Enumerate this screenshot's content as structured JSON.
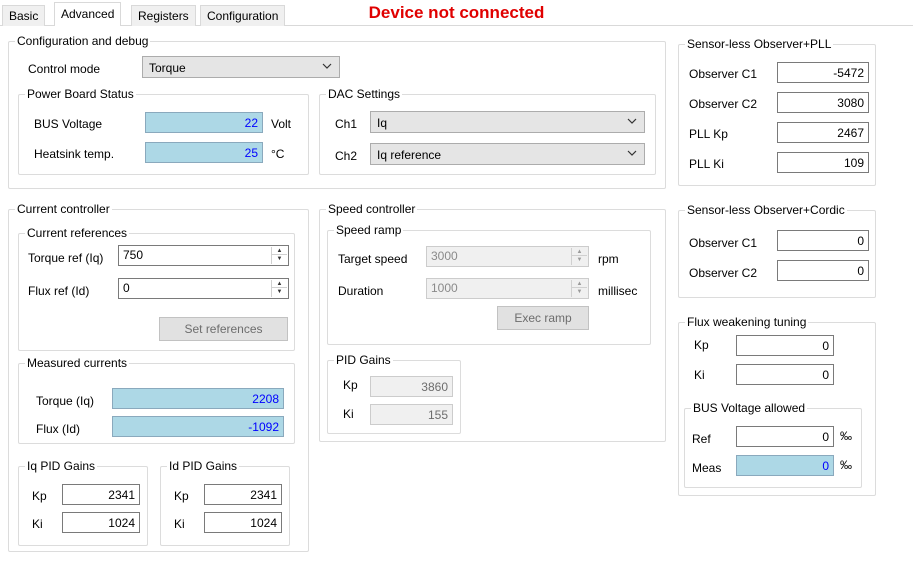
{
  "tabs": [
    {
      "label": "Basic"
    },
    {
      "label": "Advanced"
    },
    {
      "label": "Registers"
    },
    {
      "label": "Configuration"
    }
  ],
  "status": {
    "text": "Device not connected",
    "color": "#e00000"
  },
  "config_debug": {
    "title": "Configuration and debug",
    "control_mode_label": "Control mode",
    "control_mode_value": "Torque"
  },
  "power_board": {
    "title": "Power Board Status",
    "bus_voltage_label": "BUS Voltage",
    "bus_voltage_value": "22",
    "bus_voltage_unit": "Volt",
    "heatsink_label": "Heatsink temp.",
    "heatsink_value": "25",
    "heatsink_unit": "°C"
  },
  "dac": {
    "title": "DAC Settings",
    "ch1_label": "Ch1",
    "ch1_value": "Iq",
    "ch2_label": "Ch2",
    "ch2_value": "Iq reference"
  },
  "observer_pll": {
    "title": "Sensor-less Observer+PLL",
    "c1_label": "Observer C1",
    "c1_value": "-5472",
    "c2_label": "Observer C2",
    "c2_value": "3080",
    "kp_label": "PLL Kp",
    "kp_value": "2467",
    "ki_label": "PLL Ki",
    "ki_value": "109"
  },
  "observer_cordic": {
    "title": "Sensor-less Observer+Cordic",
    "c1_label": "Observer C1",
    "c1_value": "0",
    "c2_label": "Observer C2",
    "c2_value": "0"
  },
  "flux_weakening": {
    "title": "Flux weakening tuning",
    "kp_label": "Kp",
    "kp_value": "0",
    "ki_label": "Ki",
    "ki_value": "0",
    "bus_title": "BUS Voltage allowed",
    "ref_label": "Ref",
    "ref_value": "0",
    "ref_unit": "‰",
    "meas_label": "Meas",
    "meas_value": "0",
    "meas_unit": "‰"
  },
  "current_controller": {
    "title": "Current controller",
    "refs_title": "Current references",
    "torque_ref_label": "Torque ref (Iq)",
    "torque_ref_value": "750",
    "flux_ref_label": "Flux ref (Id)",
    "flux_ref_value": "0",
    "set_refs_button": "Set references",
    "measured_title": "Measured currents",
    "torque_label": "Torque (Iq)",
    "torque_value": "2208",
    "flux_label": "Flux (Id)",
    "flux_value": "-1092",
    "iq_pid_title": "Iq PID Gains",
    "iq_kp_label": "Kp",
    "iq_kp_value": "2341",
    "iq_ki_label": "Ki",
    "iq_ki_value": "1024",
    "id_pid_title": "Id PID Gains",
    "id_kp_label": "Kp",
    "id_kp_value": "2341",
    "id_ki_label": "Ki",
    "id_ki_value": "1024"
  },
  "speed_controller": {
    "title": "Speed controller",
    "ramp_title": "Speed ramp",
    "target_label": "Target speed",
    "target_value": "3000",
    "target_unit": "rpm",
    "duration_label": "Duration",
    "duration_value": "1000",
    "duration_unit": "millisec",
    "exec_button": "Exec ramp",
    "pid_title": "PID Gains",
    "kp_label": "Kp",
    "kp_value": "3860",
    "ki_label": "Ki",
    "ki_value": "155"
  }
}
